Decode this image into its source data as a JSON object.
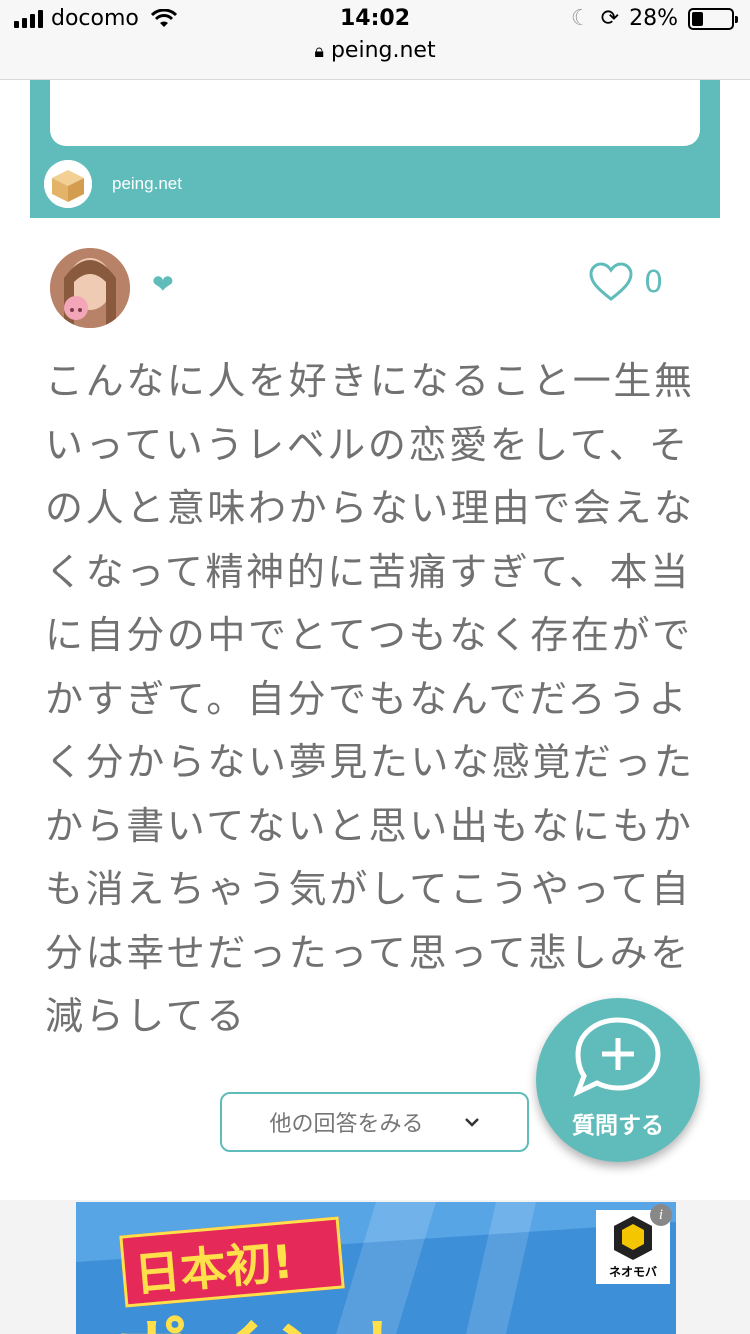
{
  "status_bar": {
    "carrier": "docomo",
    "time": "14:02",
    "battery": "28%",
    "battery_level": 0.28,
    "url": "peing.net"
  },
  "embed_card": {
    "site_label": "peing.net"
  },
  "post": {
    "badge_icon": "❤",
    "like_count": "0",
    "answer_text": "こんなに人を好きになること一生無いっていうレベルの恋愛をして、その人と意味わからない理由で会えなくなって精神的に苦痛すぎて、本当に自分の中でとてつもなく存在がでかすぎて。自分でもなんでだろうよく分からない夢見たいな感覚だったから書いてないと思い出もなにもかも消えちゃう気がしてこうやって自分は幸せだったって思って悲しみを減らしてる"
  },
  "actions": {
    "more_answers": "他の回答をみる",
    "ask_question": "質問する"
  },
  "ad": {
    "headline": "日本初!",
    "subline": "ポイント",
    "brand": "ネオモバ",
    "info": "i"
  },
  "colors": {
    "accent": "#5fbcbb",
    "text": "#717171"
  }
}
